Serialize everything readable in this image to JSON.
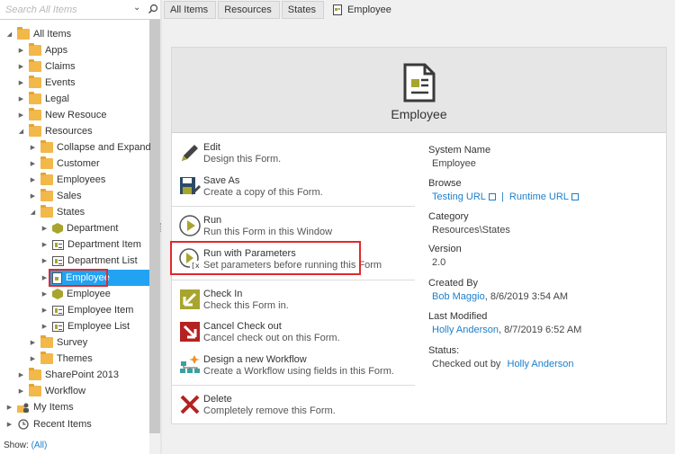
{
  "search": {
    "placeholder": "Search All Items"
  },
  "tree": {
    "root": "All Items",
    "items": [
      {
        "label": "Apps"
      },
      {
        "label": "Claims"
      },
      {
        "label": "Events"
      },
      {
        "label": "Legal"
      },
      {
        "label": "New Resouce"
      },
      {
        "label": "Resources"
      },
      {
        "label": "Collapse and Expand"
      },
      {
        "label": "Customer"
      },
      {
        "label": "Employees"
      },
      {
        "label": "Sales"
      },
      {
        "label": "States"
      },
      {
        "label": "Department"
      },
      {
        "label": "Department Item"
      },
      {
        "label": "Department List"
      },
      {
        "label": "Employee"
      },
      {
        "label": "Employee"
      },
      {
        "label": "Employee Item"
      },
      {
        "label": "Employee List"
      },
      {
        "label": "Survey"
      },
      {
        "label": "Themes"
      },
      {
        "label": "SharePoint 2013"
      },
      {
        "label": "Workflow"
      },
      {
        "label": "My Items"
      },
      {
        "label": "Recent Items"
      }
    ]
  },
  "show": {
    "label": "Show:",
    "value": "(All)"
  },
  "breadcrumb": {
    "items": [
      "All Items",
      "Resources",
      "States"
    ],
    "current": "Employee"
  },
  "form": {
    "title": "Employee"
  },
  "actions": [
    {
      "title": "Edit",
      "desc": "Design this Form."
    },
    {
      "title": "Save As",
      "desc": "Create a copy of this Form."
    },
    {
      "title": "Run",
      "desc": "Run this Form in this Window"
    },
    {
      "title": "Run with Parameters",
      "desc": "Set parameters before running this Form"
    },
    {
      "title": "Check In",
      "desc": "Check this Form in."
    },
    {
      "title": "Cancel Check out",
      "desc": "Cancel check out on this Form."
    },
    {
      "title": "Design a new Workflow",
      "desc": "Create a Workflow using fields in this Form."
    },
    {
      "title": "Delete",
      "desc": "Completely remove this Form."
    }
  ],
  "properties": {
    "system_name": {
      "label": "System Name",
      "value": "Employee"
    },
    "browse": {
      "label": "Browse",
      "testing": "Testing URL",
      "sep": "|",
      "runtime": "Runtime URL"
    },
    "category": {
      "label": "Category",
      "value": "Resources\\States"
    },
    "version": {
      "label": "Version",
      "value": "2.0"
    },
    "created_by": {
      "label": "Created By",
      "user": "Bob Maggio",
      "date": ", 8/6/2019 3:54 AM"
    },
    "last_modified": {
      "label": "Last Modified",
      "user": "Holly Anderson",
      "date": ", 8/7/2019 6:52 AM"
    },
    "status": {
      "label": "Status:",
      "prefix": "Checked out by",
      "user": "Holly Anderson"
    }
  },
  "colors": {
    "selection": "#22a2f2",
    "highlight": "#e02a2a",
    "link": "#1b7fcc",
    "folder": "#f2b84a",
    "accent": "#a7a52e"
  }
}
